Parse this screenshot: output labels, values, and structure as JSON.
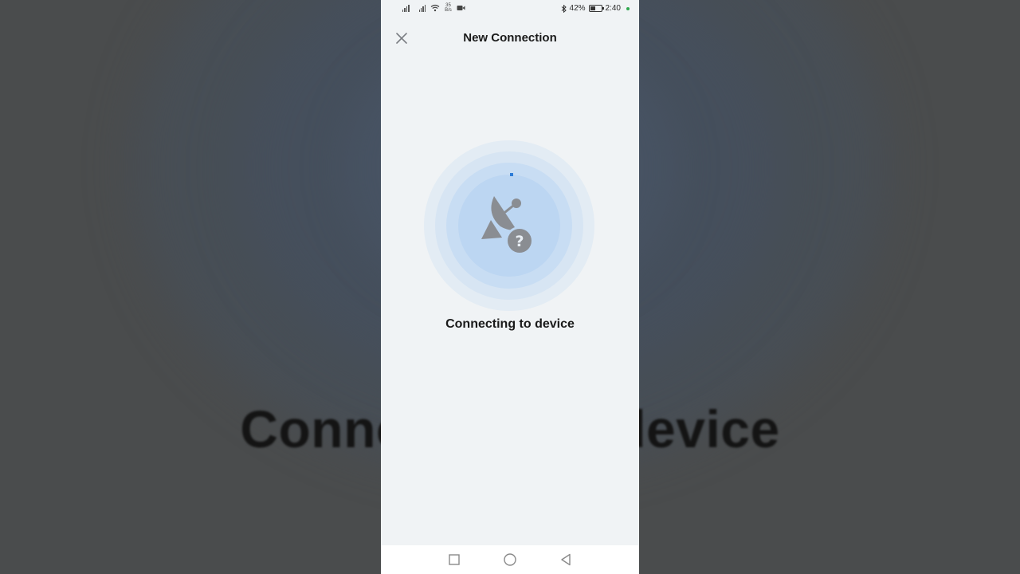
{
  "backdrop": {
    "blurred_caption": "Connecting to device"
  },
  "status_bar": {
    "network_speed_value": "35",
    "network_speed_unit": "B/s",
    "battery_percent": "42%",
    "battery_level": 0.42,
    "time": "2:40"
  },
  "header": {
    "title": "New Connection"
  },
  "main": {
    "status_text": "Connecting to device"
  },
  "icons": {
    "close": "close-icon",
    "device": "satellite-dish-question-icon",
    "bluetooth": "bluetooth-icon",
    "wifi": "wifi-icon",
    "video": "video-camera-icon",
    "signal": "signal-strength-icon",
    "battery": "battery-icon",
    "nav_recents": "square-recents-icon",
    "nav_home": "circle-home-icon",
    "nav_back": "triangle-back-icon"
  },
  "colors": {
    "screen_bg": "#f0f3f5",
    "accent": "#2e7dd7",
    "ring": "#bcd6f2",
    "icon_gray": "#8a8d92"
  }
}
